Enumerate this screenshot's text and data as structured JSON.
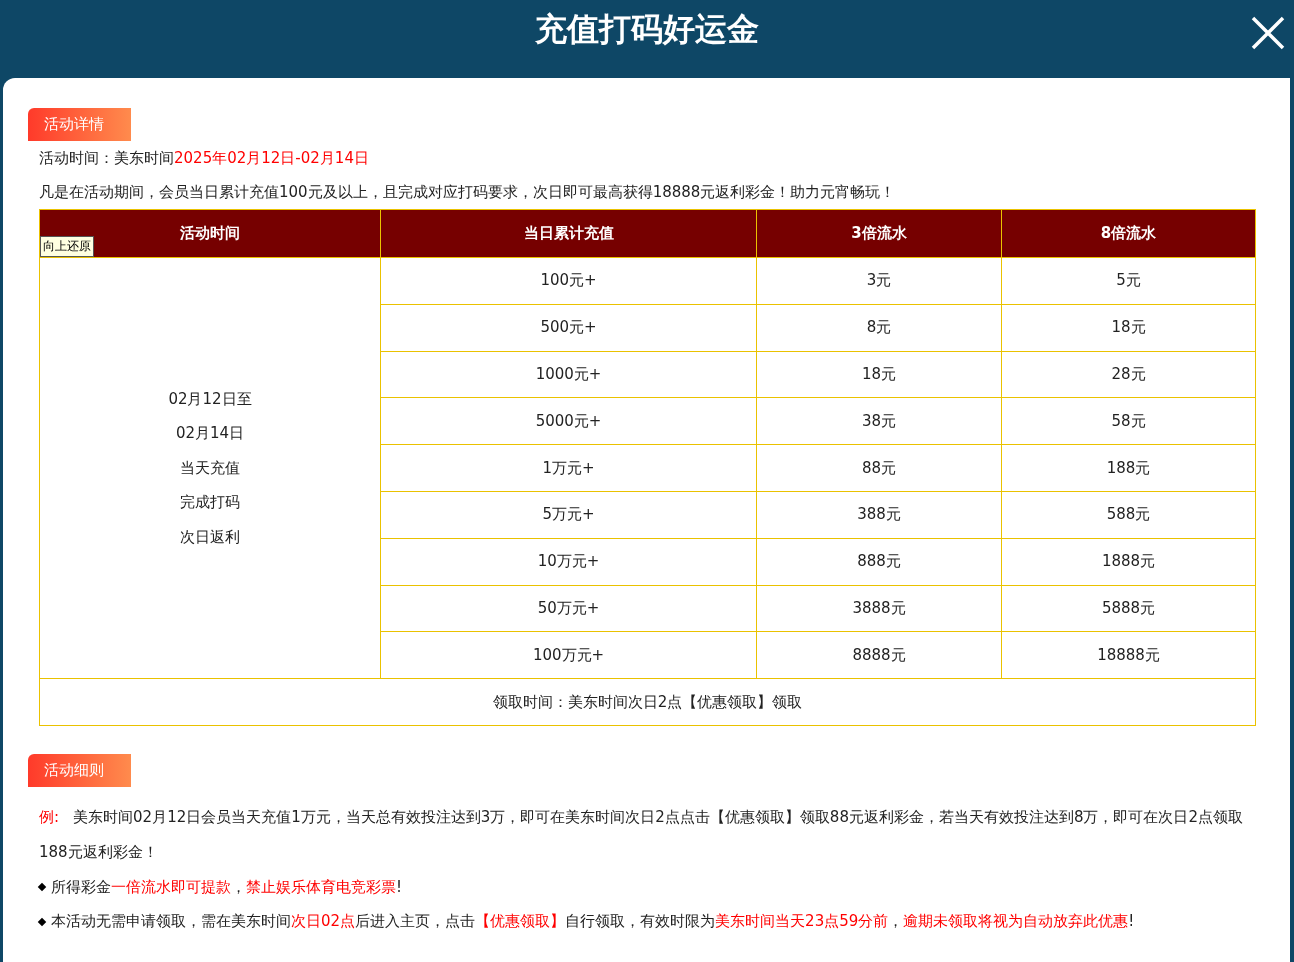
{
  "header": {
    "title": "充值打码好运金"
  },
  "details": {
    "label": "活动详情",
    "time": [
      {
        "text": "活动时间：美东时间",
        "highlight": false
      },
      {
        "text": "2025年02月12日-02月14日",
        "highlight": true
      }
    ],
    "description": "凡是在活动期间，会员当日累计充值100元及以上，且完成对应打码要求，次日即可最高获得18888元返利彩金！助力元宵畅玩！"
  },
  "table": {
    "tooltip": "向上还原",
    "columns": [
      "活动时间",
      "当日累计充值",
      "3倍流水",
      "8倍流水"
    ],
    "period": [
      "02月12日至",
      "02月14日",
      "当天充值",
      "完成打码",
      "次日返利"
    ],
    "rows": [
      {
        "deposit": "100元+",
        "x3": "3元",
        "x8": "5元"
      },
      {
        "deposit": "500元+",
        "x3": "8元",
        "x8": "18元"
      },
      {
        "deposit": "1000元+",
        "x3": "18元",
        "x8": "28元"
      },
      {
        "deposit": "5000元+",
        "x3": "38元",
        "x8": "58元"
      },
      {
        "deposit": "1万元+",
        "x3": "88元",
        "x8": "188元"
      },
      {
        "deposit": "5万元+",
        "x3": "388元",
        "x8": "588元"
      },
      {
        "deposit": "10万元+",
        "x3": "888元",
        "x8": "1888元"
      },
      {
        "deposit": "50万元+",
        "x3": "3888元",
        "x8": "5888元"
      },
      {
        "deposit": "100万元+",
        "x3": "8888元",
        "x8": "18888元"
      }
    ],
    "footer": "领取时间：美东时间次日2点【优惠领取】领取"
  },
  "rules": {
    "label": "活动细则",
    "example_label": "例:",
    "example": "美东时间02月12日会员当天充值1万元，当天总有效投注达到3万，即可在美东时间次日2点点击【优惠领取】领取88元返利彩金，若当天有效投注达到8万，即可在次日2点领取188元返利彩金！",
    "items": [
      [
        {
          "text": "所得彩金",
          "highlight": false
        },
        {
          "text": "一倍流水即可提款",
          "highlight": true
        },
        {
          "text": "，",
          "highlight": false
        },
        {
          "text": "禁止娱乐体育电竞彩票",
          "highlight": true
        },
        {
          "text": "!",
          "highlight": false
        }
      ],
      [
        {
          "text": "本活动无需申请领取，需在美东时间",
          "highlight": false
        },
        {
          "text": "次日02点",
          "highlight": true
        },
        {
          "text": "后进入主页，点击",
          "highlight": false
        },
        {
          "text": "【优惠领取】",
          "highlight": true
        },
        {
          "text": "自行领取，有效时限为",
          "highlight": false
        },
        {
          "text": "美东时间当天23点59分前",
          "highlight": true
        },
        {
          "text": "，",
          "highlight": false
        },
        {
          "text": "逾期未领取将视为自动放弃此优惠",
          "highlight": true
        },
        {
          "text": "!",
          "highlight": false
        }
      ]
    ]
  }
}
